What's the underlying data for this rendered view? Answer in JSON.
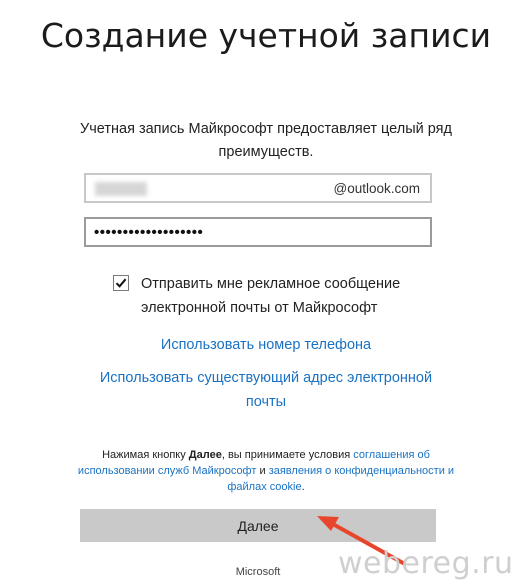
{
  "page": {
    "title": "Создание учетной записи",
    "subtitle": "Учетная запись Майкрософт предоставляет целый ряд преимуществ."
  },
  "form": {
    "email_domain": "@outlook.com",
    "password_value": "•••••••••••••••••••",
    "promo_checkbox": {
      "checked": true,
      "label": "Отправить мне рекламное сообщение электронной почты от Майкрософт"
    }
  },
  "links": {
    "use_phone": "Использовать номер телефона",
    "use_existing_email": "Использовать существующий адрес электронной почты"
  },
  "legal": {
    "prefix": "Нажимая кнопку ",
    "button_ref": "Далее",
    "middle": ", вы принимаете условия ",
    "terms_link": "соглашения об использовании служб Майкрософт",
    "and": " и ",
    "privacy_link": "заявления о конфиденциальности и файлах cookie",
    "suffix": "."
  },
  "next_button_label": "Далее",
  "brand": "Microsoft",
  "watermark": "webereg.ru",
  "annotation_arrow_color": "#e8462c",
  "link_color": "#1a72c4"
}
